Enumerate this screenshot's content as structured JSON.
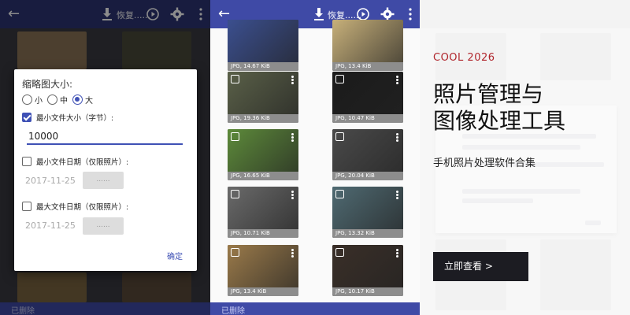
{
  "toolbar": {
    "restore_label": "恢复......",
    "bottom_label": "已删除"
  },
  "dialog": {
    "title": "缩略图大小:",
    "size_options": [
      "小",
      "中",
      "大"
    ],
    "selected_size": "大",
    "min_size_label": "最小文件大小（字节）:",
    "min_size_checked": true,
    "min_size_value": "10000",
    "min_date_label": "最小文件日期（仅限照片）:",
    "min_date_checked": false,
    "min_date_value": "2017-11-25",
    "min_date_button": "......",
    "max_date_label": "最大文件日期（仅限照片）:",
    "max_date_checked": false,
    "max_date_value": "2017-11-25",
    "max_date_button": "......",
    "ok_label": "确定"
  },
  "grid": {
    "cells": [
      {
        "caption": "JPG, 14.67 KiB",
        "tone": "#3b4f8f"
      },
      {
        "caption": "JPG, 13.4 KiB",
        "tone": "#c7b07a"
      },
      {
        "caption": "JPG, 19.36 KiB",
        "tone": "#5a6048"
      },
      {
        "caption": "JPG, 10.47 KiB",
        "tone": "#1b1b1b"
      },
      {
        "caption": "JPG, 16.65 KiB",
        "tone": "#5d8a3a"
      },
      {
        "caption": "JPG, 20.04 KiB",
        "tone": "#4a4a4a"
      },
      {
        "caption": "JPG, 10.71 KiB",
        "tone": "#6a6a6a"
      },
      {
        "caption": "JPG, 13.32 KiB",
        "tone": "#4f6a72"
      },
      {
        "caption": "JPG, 13.4 KiB",
        "tone": "#9a7a4a"
      },
      {
        "caption": "JPG, 10.17 KiB",
        "tone": "#3a2f28"
      }
    ]
  },
  "promo": {
    "kicker": "COOL 2026",
    "headline_line1": "照片管理与",
    "headline_line2": "图像处理工具",
    "subline": "手机照片处理软件合集",
    "cta": "立即查看 >"
  },
  "colors": {
    "appbar": "#3f4aa6",
    "accent": "#3f51b5",
    "kicker": "#b0242b",
    "cta_bg": "#1c1c22"
  }
}
